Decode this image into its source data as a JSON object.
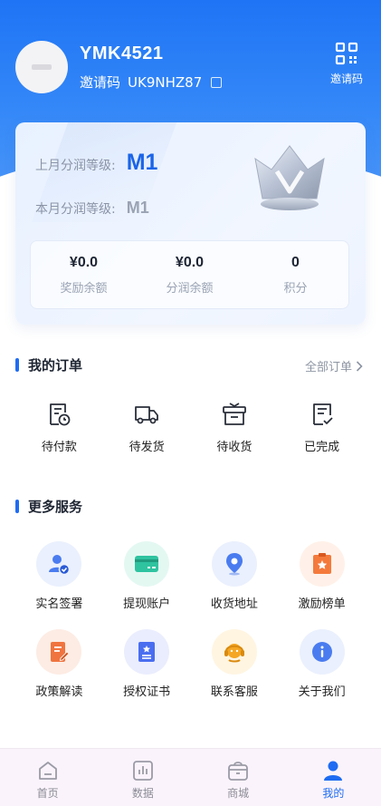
{
  "profile": {
    "username": "YMK4521",
    "invite_label": "邀请码",
    "invite_code": "UK9NHZ87",
    "qr_label": "邀请码"
  },
  "level_card": {
    "last_month_label": "上月分润等级:",
    "last_month_value": "M1",
    "this_month_label": "本月分润等级:",
    "this_month_value": "M1",
    "balances": [
      {
        "value": "¥0.0",
        "label": "奖励余额"
      },
      {
        "value": "¥0.0",
        "label": "分润余额"
      },
      {
        "value": "0",
        "label": "积分"
      }
    ]
  },
  "orders": {
    "title": "我的订单",
    "all_link": "全部订单",
    "items": [
      {
        "label": "待付款",
        "icon": "pending-payment-icon"
      },
      {
        "label": "待发货",
        "icon": "truck-icon"
      },
      {
        "label": "待收货",
        "icon": "package-icon"
      },
      {
        "label": "已完成",
        "icon": "completed-doc-icon"
      }
    ]
  },
  "services": {
    "title": "更多服务",
    "items": [
      {
        "label": "实名签署",
        "icon": "user-verify-icon",
        "color": "#4a7cf0",
        "bg": "#eaf0fd"
      },
      {
        "label": "提现账户",
        "icon": "card-icon",
        "color": "#2fc3a0",
        "bg": "#e4f8f2"
      },
      {
        "label": "收货地址",
        "icon": "location-icon",
        "color": "#4a7cf0",
        "bg": "#eaf0fd"
      },
      {
        "label": "激励榜单",
        "icon": "ranking-icon",
        "color": "#f47a3c",
        "bg": "#fff1e9"
      },
      {
        "label": "政策解读",
        "icon": "policy-doc-icon",
        "color": "#f0743f",
        "bg": "#fdece4"
      },
      {
        "label": "授权证书",
        "icon": "certificate-icon",
        "color": "#4a6ef0",
        "bg": "#eaedfd"
      },
      {
        "label": "联系客服",
        "icon": "customer-service-icon",
        "color": "#f5a623",
        "bg": "#fff5e1"
      },
      {
        "label": "关于我们",
        "icon": "info-icon",
        "color": "#4a7cf0",
        "bg": "#eaf0fd"
      }
    ]
  },
  "tabbar": {
    "items": [
      {
        "label": "首页",
        "icon": "home-icon",
        "active": false
      },
      {
        "label": "数据",
        "icon": "data-chart-icon",
        "active": false
      },
      {
        "label": "商城",
        "icon": "shop-bag-icon",
        "active": false
      },
      {
        "label": "我的",
        "icon": "profile-icon",
        "active": true
      }
    ],
    "active_color": "#1e6cf2"
  }
}
